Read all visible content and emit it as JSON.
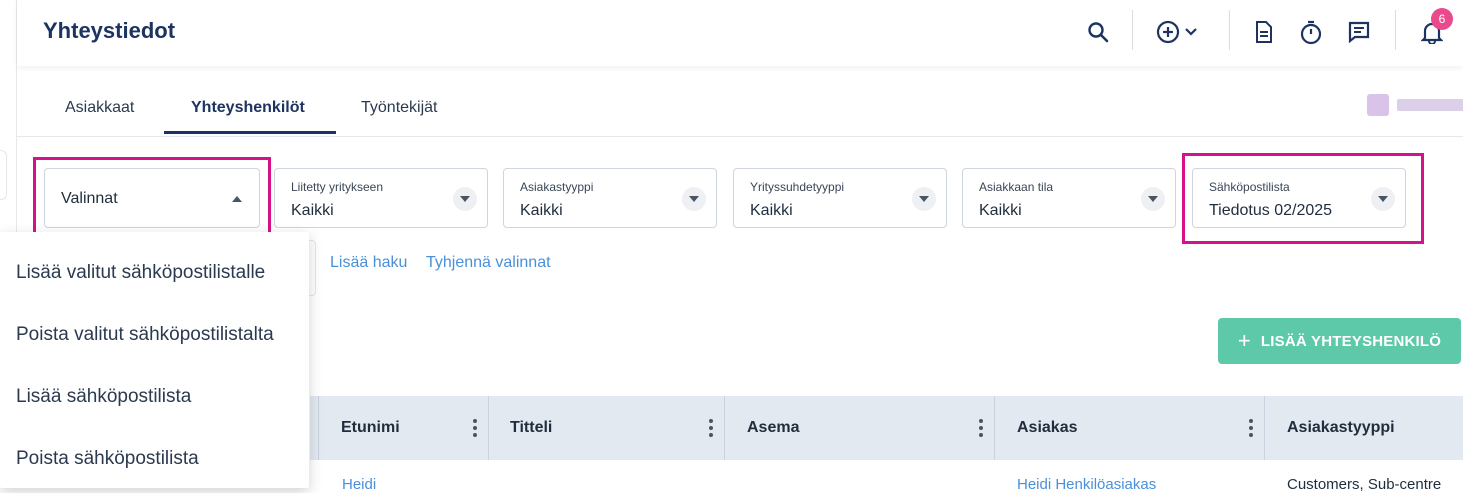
{
  "header": {
    "title": "Yhteystiedot",
    "notification_count": "6",
    "icons": [
      "search-icon",
      "add-circle-icon",
      "chevron-down-icon",
      "document-icon",
      "timer-icon",
      "chat-icon",
      "bell-icon"
    ]
  },
  "tabs": [
    {
      "label": "Asiakkaat",
      "active": false
    },
    {
      "label": "Yhteyshenkilöt",
      "active": true
    },
    {
      "label": "Työntekijät",
      "active": false
    }
  ],
  "filters": [
    {
      "label": "",
      "value": "Valinnat"
    },
    {
      "label": "Liitetty yritykseen",
      "value": "Kaikki"
    },
    {
      "label": "Asiakastyyppi",
      "value": "Kaikki"
    },
    {
      "label": "Yrityssuhdetyyppi",
      "value": "Kaikki"
    },
    {
      "label": "Asiakkaan tila",
      "value": "Kaikki"
    },
    {
      "label": "Sähköpostilista",
      "value": "Tiedotus 02/2025"
    }
  ],
  "links": {
    "add_search": "Lisää haku",
    "clear": "Tyhjennä valinnat"
  },
  "add_button": {
    "icon": "+",
    "label": "LISÄÄ YHTEYSHENKILÖ"
  },
  "menu": {
    "items": [
      "Lisää valitut sähköpostilistalle",
      "Poista valitut sähköpostilistalta",
      "Lisää sähköpostilista",
      "Poista sähköpostilista"
    ]
  },
  "table": {
    "columns": [
      "Etunimi",
      "Titteli",
      "Asema",
      "Asiakas",
      "Asiakastyyppi"
    ],
    "first_row": {
      "etunimi": "Heidi",
      "asiakas": "Heidi Henkilöasiakas",
      "asiakastyyppi": "Customers, Sub-centre"
    }
  },
  "colors": {
    "brand": "#1d3461",
    "accent": "#5ec9a8",
    "highlight": "#d6128b",
    "badge": "#e94a8c",
    "link": "#4a90d9"
  }
}
